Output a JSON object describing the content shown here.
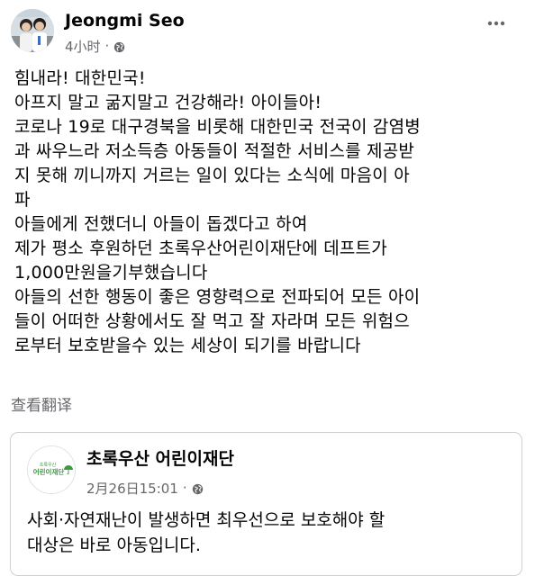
{
  "post": {
    "author": "Jeongmi Seo",
    "timestamp": "4小时",
    "privacy_icon": "globe-icon",
    "more_icon": "more-horizontal-icon",
    "lines": [
      "힘내라! 대한민국!",
      "아프지 말고 굶지말고 건강해라! 아이들아!",
      "코로나 19로 대구경북을 비롯해 대한민국 전국이 감염병",
      "과 싸우느라 저소득층 아동들이 적절한 서비스를 제공받",
      "지 못해 끼니까지 거르는 일이 있다는 소식에 마음이 아",
      "파",
      "아들에게 전했더니 아들이 돕겠다고 하여",
      "제가 평소 후원하던 초록우산어린이재단에 데프트가",
      "1,000만원을기부했습니다",
      "아들의 선한 행동이 좋은 영향력으로 전파되어 모든 아이",
      "들이 어떠한 상황에서도 잘 먹고 잘 자라며 모든 위험으",
      "로부터 보호받을수 있는 세상이 되기를 바랍니다"
    ],
    "see_translation": "查看翻译"
  },
  "shared_post": {
    "page_name": "초록우산 어린이재단",
    "logo_text_top": "초록우산",
    "logo_text_main": "어린이재단",
    "timestamp": "2月26日15:01",
    "privacy_icon": "globe-icon",
    "lines": [
      "사회·자연재난이 발생하면 최우선으로 보호해야 할",
      "대상은 바로 아동입니다."
    ]
  },
  "colors": {
    "text_primary": "#050505",
    "text_secondary": "#65676b",
    "card_border": "#ced0d4",
    "logo_green": "#3c9a3f"
  }
}
